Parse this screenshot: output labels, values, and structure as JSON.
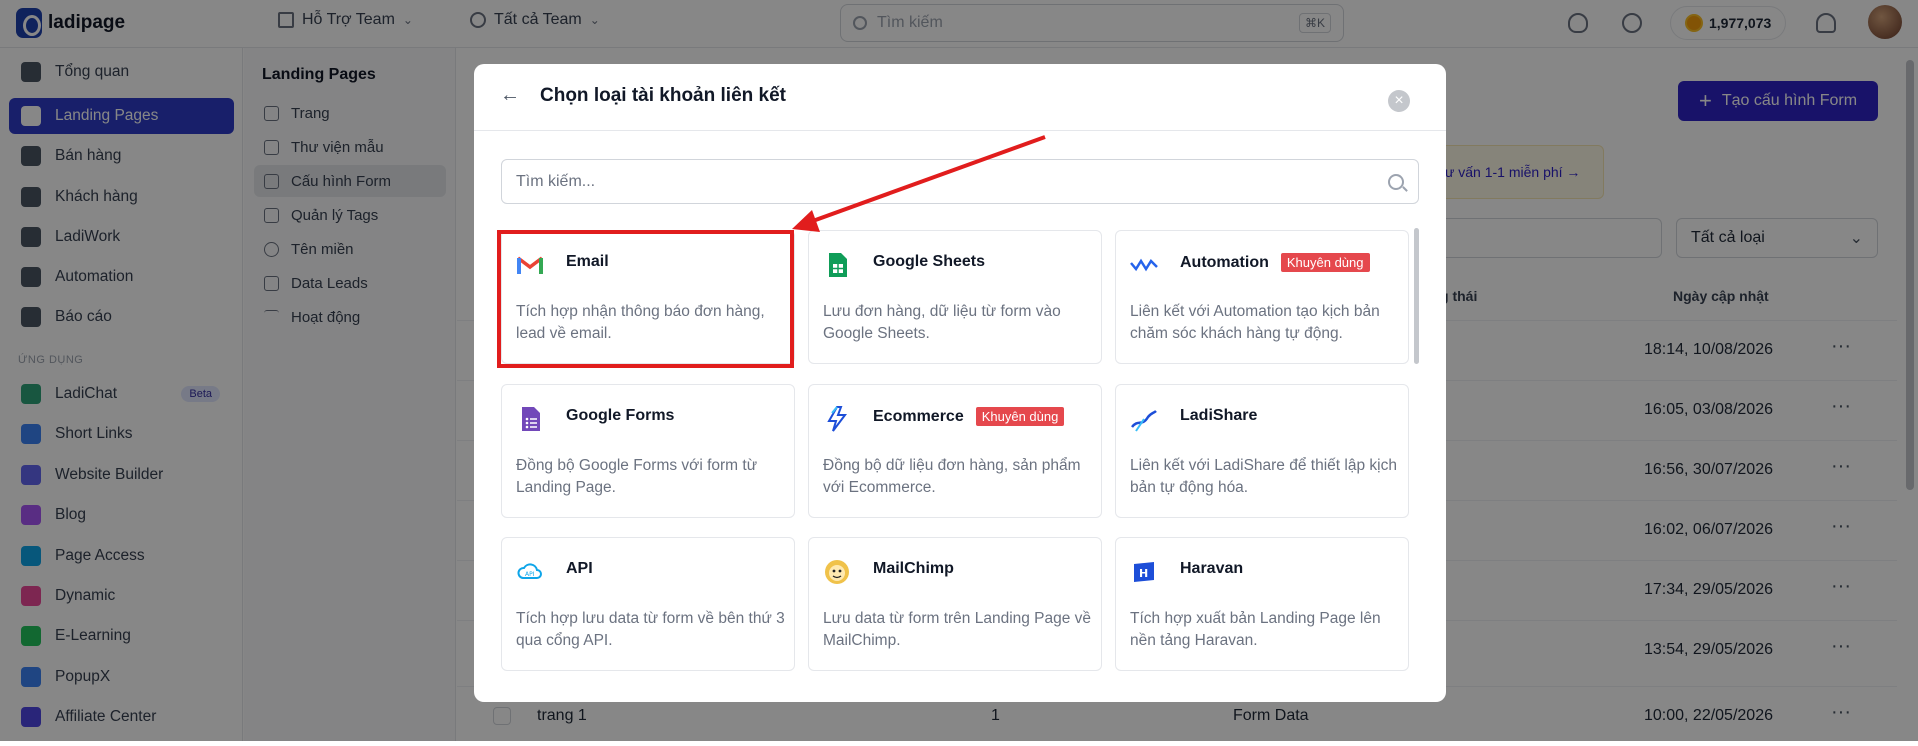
{
  "app": {
    "brand": "ladipage"
  },
  "topbar": {
    "team": "Hỗ Trợ Team",
    "team_filter": "Tất cả Team",
    "search_placeholder": "Tìm kiếm",
    "search_shortcut": "⌘K",
    "credits": "1,977,073"
  },
  "sidebar": {
    "items": [
      {
        "label": "Tổng quan"
      },
      {
        "label": "Landing Pages"
      },
      {
        "label": "Bán hàng"
      },
      {
        "label": "Khách hàng"
      },
      {
        "label": "LadiWork"
      },
      {
        "label": "Automation"
      },
      {
        "label": "Báo cáo"
      }
    ],
    "apps_heading": "ỨNG DỤNG",
    "apps": [
      {
        "label": "LadiChat",
        "badge": "Beta"
      },
      {
        "label": "Short Links"
      },
      {
        "label": "Website Builder"
      },
      {
        "label": "Blog"
      },
      {
        "label": "Page Access"
      },
      {
        "label": "Dynamic"
      },
      {
        "label": "E-Learning"
      },
      {
        "label": "PopupX"
      },
      {
        "label": "Affiliate Center"
      }
    ]
  },
  "subnav": {
    "title": "Landing Pages",
    "items": [
      {
        "label": "Trang"
      },
      {
        "label": "Thư viện mẫu"
      },
      {
        "label": "Cấu hình Form"
      },
      {
        "label": "Quản lý Tags"
      },
      {
        "label": "Tên miền"
      },
      {
        "label": "Data Leads"
      },
      {
        "label": "Hoạt động"
      }
    ]
  },
  "main": {
    "create_button": "Tạo cấu hình Form",
    "promo": "ư vấn 1-1 miễn phí →",
    "type_filter": "Tất cả loại",
    "columns": {
      "status": "g thái",
      "updated": "Ngày cập nhật"
    },
    "rows": [
      {
        "date": "18:14, 10/08/2026"
      },
      {
        "date": "16:05, 03/08/2026"
      },
      {
        "date": "16:56, 30/07/2026"
      },
      {
        "date": "16:02, 06/07/2026"
      },
      {
        "date": "17:34, 29/05/2026"
      },
      {
        "date": "13:54, 29/05/2026"
      },
      {
        "date": "10:00, 22/05/2026",
        "name": "trang 1",
        "count": "1",
        "type": "Form Data"
      }
    ]
  },
  "modal": {
    "title": "Chọn loại tài khoản liên kết",
    "search_placeholder": "Tìm kiếm...",
    "cards": [
      {
        "title": "Email",
        "desc": "Tích hợp nhận thông báo đơn hàng, lead về email.",
        "icon": "gmail-icon"
      },
      {
        "title": "Google Sheets",
        "desc": "Lưu đơn hàng, dữ liệu từ form vào Google Sheets.",
        "icon": "google-sheets-icon"
      },
      {
        "title": "Automation",
        "badge": "Khuyên dùng",
        "desc": "Liên kết với Automation tạo kịch bản chăm sóc khách hàng tự động.",
        "icon": "automation-icon"
      },
      {
        "title": "Google Forms",
        "desc": "Đồng bộ Google Forms với form từ Landing Page.",
        "icon": "google-forms-icon"
      },
      {
        "title": "Ecommerce",
        "badge": "Khuyên dùng",
        "desc": "Đồng bộ dữ liệu đơn hàng, sản phẩm với Ecommerce.",
        "icon": "ecommerce-icon"
      },
      {
        "title": "LadiShare",
        "desc": "Liên kết với LadiShare để thiết lập kịch bản tự động hóa.",
        "icon": "ladishare-icon"
      },
      {
        "title": "API",
        "desc": "Tích hợp lưu data từ form về bên thứ 3 qua cổng API.",
        "icon": "api-cloud-icon"
      },
      {
        "title": "MailChimp",
        "desc": "Lưu data từ form trên Landing Page về MailChimp.",
        "icon": "mailchimp-icon"
      },
      {
        "title": "Haravan",
        "desc": "Tích hợp xuất bản Landing Page lên nền tảng Haravan.",
        "icon": "haravan-icon"
      }
    ]
  },
  "colors": {
    "primary": "#2f23c6",
    "highlight": "#e11d1d",
    "badge": "#e5484d"
  }
}
